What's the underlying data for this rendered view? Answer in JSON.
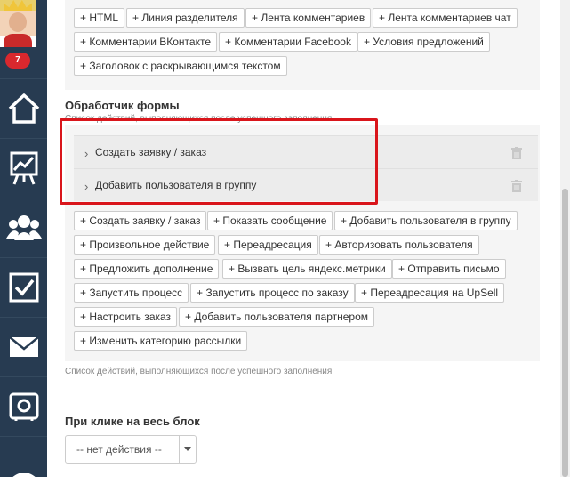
{
  "sidebar": {
    "notification_count": "7",
    "items": [
      {
        "icon": "home-icon"
      },
      {
        "icon": "analytics-icon"
      },
      {
        "icon": "users-icon"
      },
      {
        "icon": "tasks-icon"
      },
      {
        "icon": "mail-icon"
      },
      {
        "icon": "settings-icon"
      }
    ]
  },
  "top_chips": [
    "+ HTML",
    "+ Линия разделителя",
    "+ Лента комментариев",
    "+ Лента комментариев чат",
    "+ Комментарии ВКонтакте",
    "+ Комментарии Facebook",
    "+ Условия предложений",
    "+ Заголовок с раскрывающимся текстом"
  ],
  "form_handler": {
    "title": "Обработчик формы",
    "subtitle": "Список действий, выполняющихся после успешного заполнения",
    "actions": [
      "Создать заявку / заказ",
      "Добавить пользователя в группу"
    ],
    "chips": [
      "+ Создать заявку / заказ",
      "+ Показать сообщение",
      "+ Добавить пользователя в группу",
      "+ Произвольное действие",
      "+ Переадресация",
      "+ Авторизовать пользователя",
      "+ Предложить дополнение",
      "+ Вызвать цель яндекс.метрики",
      "+ Отправить письмо",
      "+ Запустить процесс",
      "+ Запустить процесс по заказу",
      "+ Переадресация на UpSell",
      "+ Настроить заказ",
      "+ Добавить пользователя партнером",
      "+ Изменить категорию рассылки"
    ],
    "footer_note": "Список действий, выполняющихся после успешного заполнения"
  },
  "click_block": {
    "title": "При клике на весь блок",
    "selected": "-- нет действия --"
  },
  "colors": {
    "sidebar_bg": "#273b51",
    "highlight": "#d9151b",
    "badge": "#d9282e"
  }
}
